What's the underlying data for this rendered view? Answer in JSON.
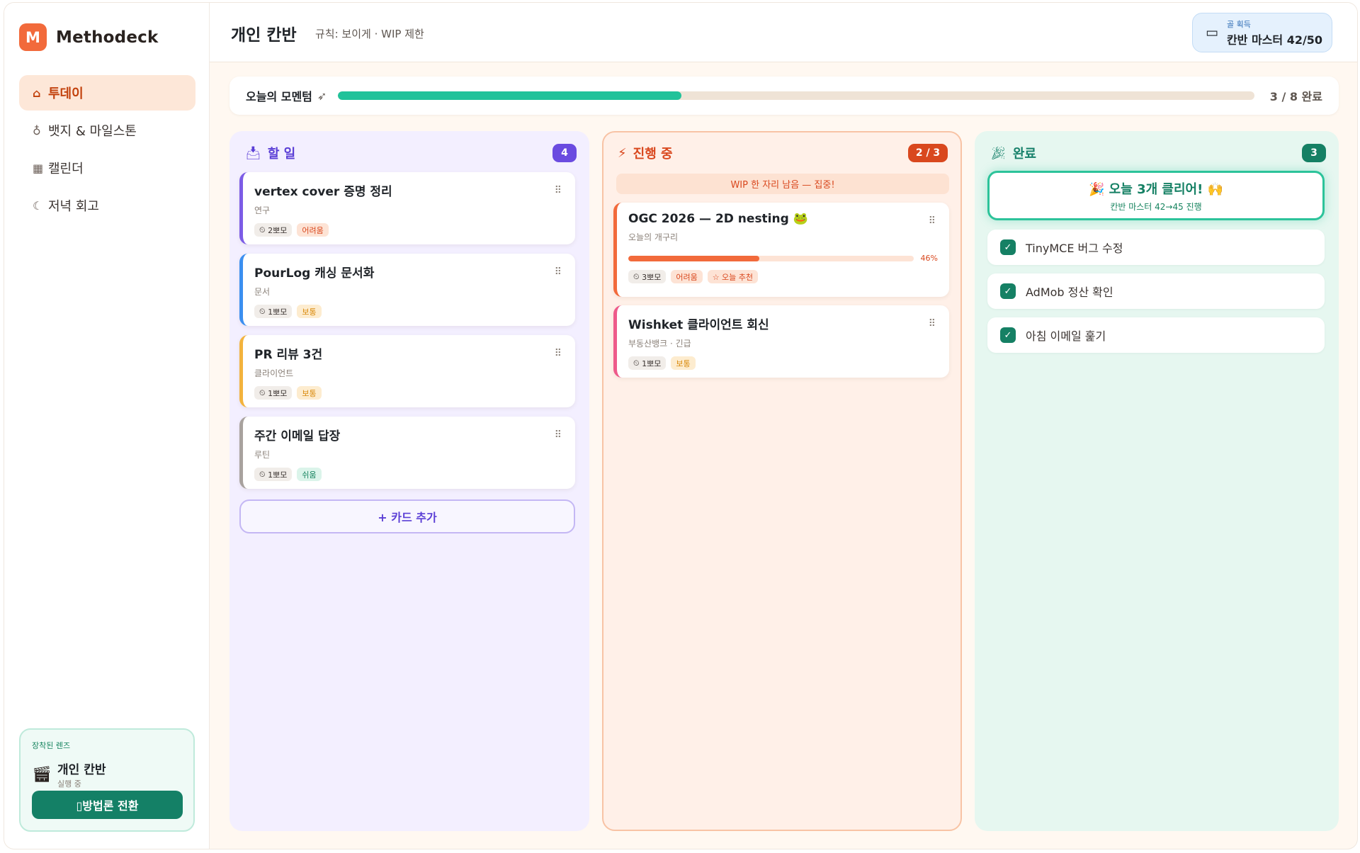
{
  "brand": {
    "logo_letter": "M",
    "name": "Methodeck"
  },
  "sidebar": {
    "items": [
      {
        "icon": "home-icon",
        "label": "투데이",
        "active": true
      },
      {
        "icon": "medal-icon",
        "label": "뱃지 & 마일스톤",
        "active": false
      },
      {
        "icon": "calendar-icon",
        "label": "캘린더",
        "active": false
      },
      {
        "icon": "moon-icon",
        "label": "저녁 회고",
        "active": false
      }
    ],
    "lens": {
      "caption": "장착된 렌즈",
      "name": "개인 칸반",
      "status": "실행 중",
      "button_label": "▯방법론 전환"
    }
  },
  "header": {
    "title": "개인 칸반",
    "rule": "규칙: 보이게 · WIP 제한",
    "goal": {
      "caption": "골 획득",
      "value": "칸반 마스터 42/50",
      "icon": "clapperboard-icon"
    }
  },
  "momentum": {
    "label": "오늘의 모멘텀",
    "icon": "rocket-icon",
    "done": 3,
    "total": 8,
    "text": "3 / 8 완료"
  },
  "columns": {
    "todo": {
      "icon": "inbox-icon",
      "title": "할 일",
      "count": "4",
      "cards": [
        {
          "title": "vertex cover 증명 정리",
          "sub": "연구",
          "pomo": "2뽀모",
          "level": "어려움",
          "level_kind": "hard",
          "color": "#7c5ce6"
        },
        {
          "title": "PourLog 캐싱 문서화",
          "sub": "문서",
          "pomo": "1뽀모",
          "level": "보통",
          "level_kind": "mid",
          "color": "#3b8ff0"
        },
        {
          "title": "PR 리뷰 3건",
          "sub": "클라이언트",
          "pomo": "1뽀모",
          "level": "보통",
          "level_kind": "mid",
          "color": "#f3b33d"
        },
        {
          "title": "주간 이메일 답장",
          "sub": "루틴",
          "pomo": "1뽀모",
          "level": "쉬움",
          "level_kind": "easy",
          "color": "#a8a29e"
        }
      ],
      "add_label": "+ 카드 추가"
    },
    "doing": {
      "icon": "bolt-icon",
      "title": "진행 중",
      "count": "2 / 3",
      "wip": "WIP 한 자리 남음 — 집중!",
      "cards": [
        {
          "title": "OGC 2026 — 2D nesting 🐸",
          "sub": "오늘의 개구리",
          "progress": 46,
          "progress_text": "46%",
          "pomo": "3뽀모",
          "level": "어려움",
          "recommend": "☆ 오늘 추천",
          "color": "#f26a3b"
        },
        {
          "title": "Wishket 클라이언트 회신",
          "sub": "부동산뱅크 · 긴급",
          "pomo": "1뽀모",
          "level": "보통",
          "color": "#ee5a8a"
        }
      ]
    },
    "done": {
      "icon": "party-icon",
      "title": "완료",
      "count": "3",
      "banner": {
        "title": "🎉 오늘 3개 클리어! 🙌",
        "sub": "칸반 마스터 42→45 진행"
      },
      "items": [
        {
          "label": "TinyMCE 버그 수정"
        },
        {
          "label": "AdMob 정산 확인"
        },
        {
          "label": "아침 이메일 훑기"
        }
      ]
    }
  },
  "colors": {
    "accent": "#f26a3b",
    "teal": "#158064",
    "purple": "#6a4be0",
    "momentum": "#21c29a"
  }
}
